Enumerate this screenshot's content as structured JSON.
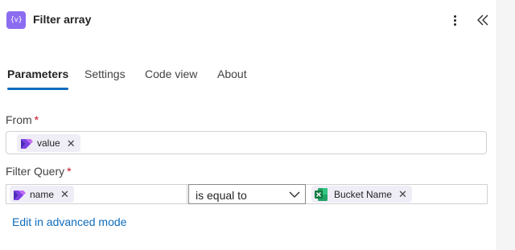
{
  "header": {
    "action_icon_text": "{v}",
    "title": "Filter array",
    "more_icon": "more-vertical-icon",
    "collapse_icon": "double-chevron-left-icon"
  },
  "tabs": [
    {
      "label": "Parameters",
      "active": true
    },
    {
      "label": "Settings",
      "active": false
    },
    {
      "label": "Code view",
      "active": false
    },
    {
      "label": "About",
      "active": false
    }
  ],
  "from": {
    "label": "From",
    "required": "*",
    "token": {
      "label": "value",
      "icon": "power-automate-icon",
      "remove": "✕"
    }
  },
  "filter_query": {
    "label": "Filter Query",
    "required": "*",
    "left_token": {
      "label": "name",
      "icon": "power-automate-icon",
      "remove": "✕"
    },
    "operator": "is equal to",
    "right_token": {
      "label": "Bucket Name",
      "icon": "excel-icon",
      "remove": "✕"
    }
  },
  "advanced_link": "Edit in advanced mode",
  "colors": {
    "accent": "#0f6cbd",
    "required": "#c50f1f",
    "action_icon_bg": "#8c6cf0",
    "token_bg": "#efedf6",
    "excel_green": "#107c41"
  }
}
